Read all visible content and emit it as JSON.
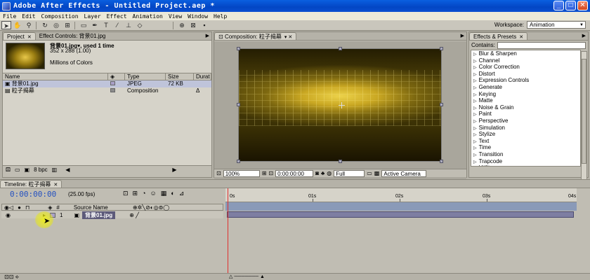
{
  "window": {
    "title": "Adobe After Effects - Untitled Project.aep *"
  },
  "menu": [
    "File",
    "Edit",
    "Composition",
    "Layer",
    "Effect",
    "Animation",
    "View",
    "Window",
    "Help"
  ],
  "menu_underline": [
    "F",
    "E",
    "C",
    "L",
    "t",
    "A",
    "V",
    "W",
    "H"
  ],
  "workspace": {
    "label": "Workspace:",
    "value": "Animation"
  },
  "project": {
    "tab_project": "Project",
    "tab_effect_controls": "Effect Controls: 背景01.jpg",
    "selected_name": "背景01.jpg▾, used 1 time",
    "selected_size": "352 x 288 (1.00)",
    "selected_color": "Millions of Colors",
    "columns": [
      "Name",
      "Type",
      "Size",
      "Durat"
    ],
    "items": [
      {
        "name": "背景01.jpg",
        "type": "JPEG",
        "size": "72 KB",
        "dur": "",
        "color": "#a9a0c8"
      },
      {
        "name": "粒子揭幕",
        "type": "Composition",
        "size": "",
        "dur": "Δ",
        "color": "#8c8c8c"
      }
    ],
    "footer_bpc": "8 bpc"
  },
  "composition": {
    "tab": "Composition: 粒子揭幕",
    "zoom": "100%",
    "timecode": "0:00:00:00",
    "resolution": "Full",
    "camera": "Active Camera"
  },
  "effects": {
    "tab": "Effects & Presets",
    "contains_label": "Contains:",
    "items": [
      "Blur & Sharpen",
      "Channel",
      "Color Correction",
      "Distort",
      "Expression Controls",
      "Generate",
      "Keying",
      "Matte",
      "Noise & Grain",
      "Paint",
      "Perspective",
      "Simulation",
      "Stylize",
      "Text",
      "Time",
      "Transition",
      "Trapcode",
      "Utility"
    ]
  },
  "timeline": {
    "tab": "Timeline: 粒子揭幕",
    "timecode": "0:00:00:00",
    "fps": "(25.00 fps)",
    "col_hash": "#",
    "col_source": "Source Name",
    "layer_index": "1",
    "layer_name": "背景01.jpg",
    "ruler": [
      "0s",
      "01s",
      "02s",
      "03s",
      "04s"
    ]
  }
}
